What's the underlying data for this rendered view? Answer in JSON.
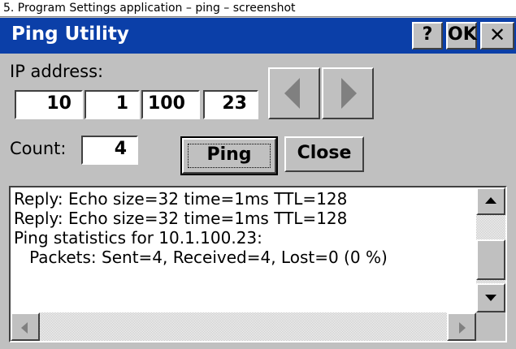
{
  "caption": "5. Program Settings application – ping – screenshot",
  "window": {
    "title": "Ping Utility",
    "help_label": "?",
    "ok_label": "OK",
    "close_label": "✕"
  },
  "ip": {
    "label": "IP address:",
    "octets": [
      "10",
      "1",
      "100",
      "23"
    ]
  },
  "count": {
    "label": "Count:",
    "value": "4"
  },
  "buttons": {
    "ping": "Ping",
    "close": "Close"
  },
  "nav": {
    "prev_icon": "left-arrow-icon",
    "next_icon": "right-arrow-icon"
  },
  "output": {
    "lines": [
      "Reply: Echo size=32 time=1ms TTL=128",
      "Reply: Echo size=32 time=1ms TTL=128",
      "Ping statistics for 10.1.100.23:",
      "   Packets: Sent=4, Received=4, Lost=0 (0 %)"
    ]
  },
  "colors": {
    "titlebar": "#0b3fa8",
    "window_bg": "#c0c0c0"
  }
}
